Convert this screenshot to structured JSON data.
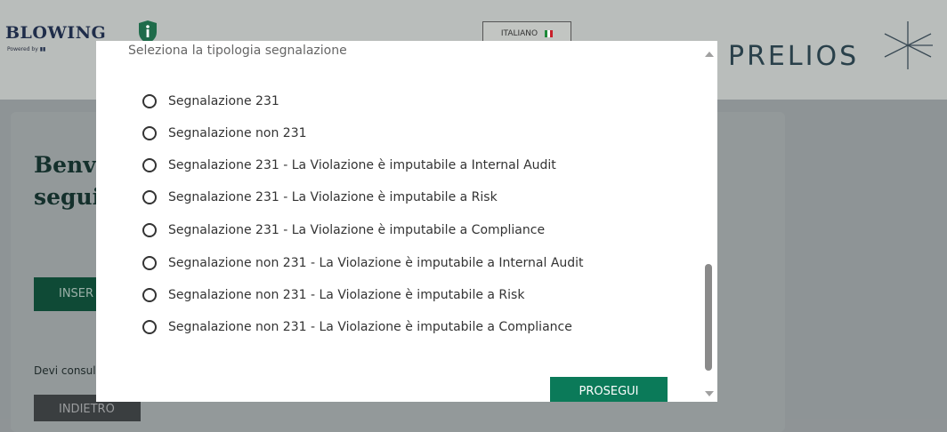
{
  "background": {
    "logo_text": "BLOWING",
    "logo_powered": "Powered by",
    "language": "ITALIANO",
    "brand": "PRELIOS",
    "welcome_line1": "Benve",
    "welcome_line2": "segui",
    "insert_button": "INSER",
    "devi_text": "Devi consul",
    "back_button": "INDIETRO"
  },
  "modal": {
    "title": "Seleziona la tipologia segnalazione",
    "options": [
      "Segnalazione 231",
      "Segnalazione non 231",
      "Segnalazione 231 - La Violazione è imputabile a Internal Audit",
      "Segnalazione 231 - La Violazione è imputabile a Risk",
      "Segnalazione 231 - La Violazione è imputabile a Compliance",
      "Segnalazione non 231 - La Violazione è imputabile a Internal Audit",
      "Segnalazione non 231 - La Violazione è imputabile a Risk",
      "Segnalazione non 231 - La Violazione è imputabile a Compliance"
    ],
    "submit_button": "PROSEGUI"
  },
  "colors": {
    "primary": "#0b7a59",
    "brand_dark": "#29404a",
    "flag_green": "#1f8a3a",
    "flag_white": "#ffffff",
    "flag_red": "#c8202a"
  },
  "icons": {
    "info": "info-shield-icon",
    "flag": "italy-flag-icon",
    "star": "prelios-star-icon",
    "radio": "radio-unchecked-icon",
    "scroll_up": "scroll-up-arrow-icon",
    "scroll_down": "scroll-down-arrow-icon"
  }
}
